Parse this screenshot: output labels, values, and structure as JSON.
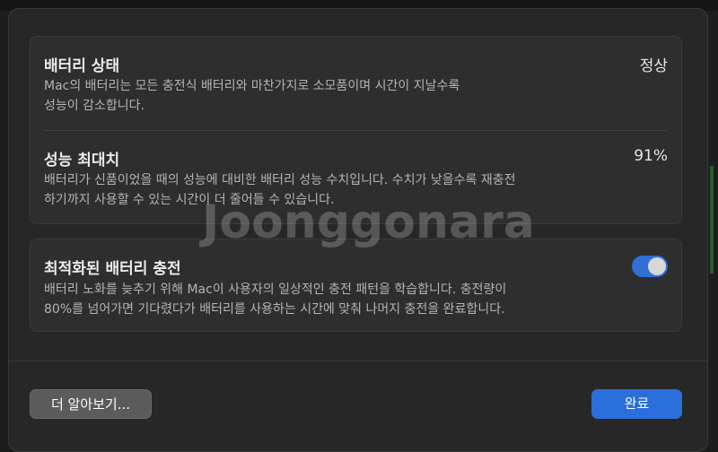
{
  "battery_status": {
    "title": "배터리 상태",
    "value": "정상",
    "description": "Mac의 배터리는 모든 충전식 배터리와 마찬가지로 소모품이며 시간이 지날수록\n성능이 감소합니다."
  },
  "max_capacity": {
    "title": "성능 최대치",
    "value": "91%",
    "description": "배터리가 신품이었을 때의 성능에 대비한 배터리 성능 수치입니다. 수치가 낮을수록 재충전\n하기까지 사용할 수 있는 시간이 더 줄어들 수 있습니다."
  },
  "optimized_charging": {
    "title": "최적화된 배터리 충전",
    "enabled": true,
    "description": "배터리 노화를 늦추기 위해 Mac이 사용자의 일상적인 충전 패턴을 학습합니다. 충전량이\n80%를 넘어가면 기다렸다가 배터리를 사용하는 시간에 맞춰 나머지 충전을 완료합니다."
  },
  "buttons": {
    "learn_more": "더 알아보기...",
    "done": "완료"
  },
  "watermark": "Joonggonara",
  "colors": {
    "accent": "#2a6fdb",
    "sheet_bg": "#272727",
    "card_bg": "#2e2e2e"
  }
}
